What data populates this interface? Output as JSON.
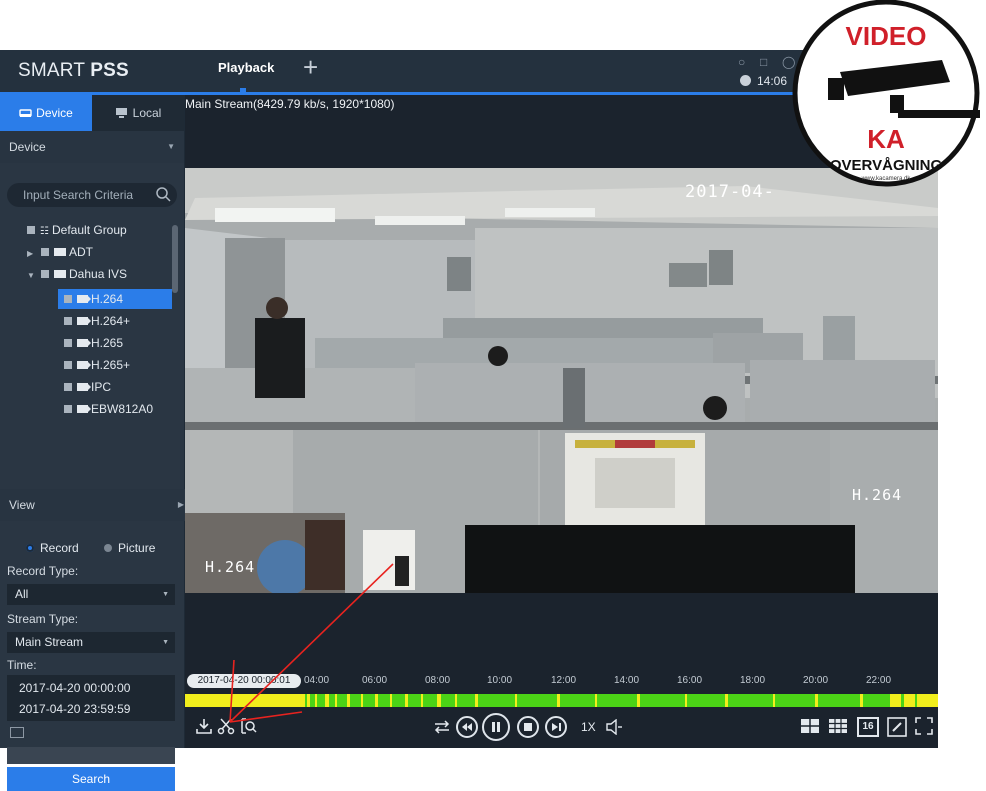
{
  "header": {
    "brand_light": "SMART ",
    "brand_bold": "PSS",
    "tab_playback": "Playback",
    "add_tab": "+",
    "time": "14:06"
  },
  "sidebar": {
    "tabs": [
      {
        "label": "Device"
      },
      {
        "label": "Local"
      }
    ],
    "device_section": "Device",
    "search_placeholder": "Input Search Criteria",
    "tree": [
      {
        "label": "Default Group"
      },
      {
        "label": "ADT"
      },
      {
        "label": "Dahua IVS"
      },
      {
        "label": "H.264"
      },
      {
        "label": "H.264+"
      },
      {
        "label": "H.265"
      },
      {
        "label": "H.265+"
      },
      {
        "label": "IPC"
      },
      {
        "label": "EBW812A0"
      }
    ],
    "view_section": "View",
    "record_label": "Record",
    "picture_label": "Picture",
    "record_type_label": "Record Type:",
    "record_type_value": "All",
    "stream_type_label": "Stream Type:",
    "stream_type_value": "Main Stream",
    "time_label": "Time:",
    "time_start": "2017-04-20 00:00:00",
    "time_end": "2017-04-20 23:59:59",
    "search_button": "Search"
  },
  "player": {
    "stream_info": "Main Stream(8429.79 kb/s, 1920*1080)",
    "osd_timestamp": "2017-04-",
    "osd_label_right": "H.264",
    "osd_label_left": "H.264",
    "current_time": "2017-04-20 00:00:01",
    "ticks": [
      "04:00",
      "06:00",
      "08:00",
      "10:00",
      "12:00",
      "14:00",
      "16:00",
      "18:00",
      "20:00",
      "22:00"
    ],
    "speed": "1X",
    "grid_16": "16"
  },
  "watermark": {
    "top": "VIDEO",
    "brand": "KA",
    "bottom": "OVERVÅGNING",
    "url": "www.kacamera.dk"
  },
  "colors": {
    "accent": "#2b7de9",
    "track_green": "#4bd316",
    "track_yellow": "#f1ee1c",
    "annotation_red": "#e8231f"
  }
}
